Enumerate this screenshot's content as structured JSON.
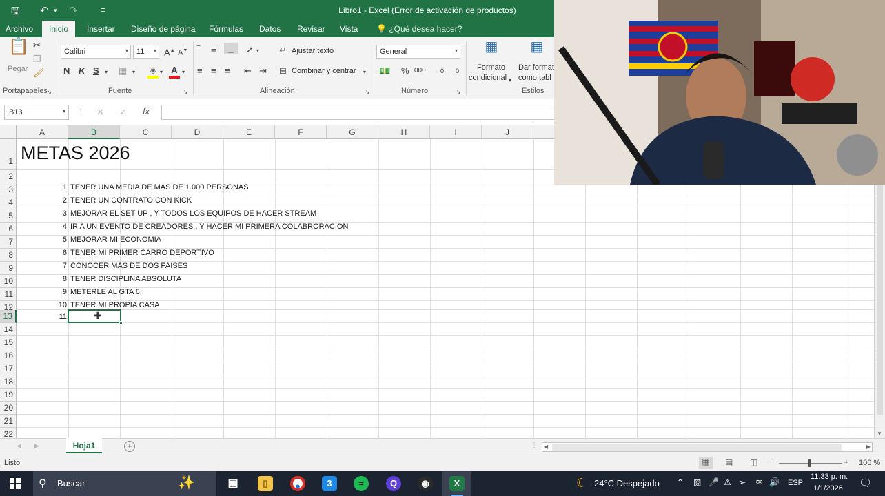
{
  "window": {
    "title": "Libro1 - Excel (Error de activación de productos)"
  },
  "ribbon_tabs": [
    "Archivo",
    "Inicio",
    "Insertar",
    "Diseño de página",
    "Fórmulas",
    "Datos",
    "Revisar",
    "Vista"
  ],
  "tell_me": "¿Qué desea hacer?",
  "ribbon": {
    "paste_label": "Pegar",
    "clipboard_label": "Portapapeles",
    "font_name": "Calibri",
    "font_size": "11",
    "font_label": "Fuente",
    "bold": "N",
    "italic": "K",
    "underline": "S",
    "wrap_text": "Ajustar texto",
    "merge_center": "Combinar y centrar",
    "alignment_label": "Alineación",
    "number_format": "General",
    "number_label": "Número",
    "cond_format_line1": "Formato",
    "cond_format_line2": "condicional",
    "table_format_line1": "Dar format",
    "table_format_line2": "como tabl",
    "styles_label": "Estilos"
  },
  "formula_bar": {
    "name_box": "B13",
    "fx": "fx",
    "formula": ""
  },
  "columns": [
    "A",
    "B",
    "C",
    "D",
    "E",
    "F",
    "G",
    "H",
    "I",
    "J"
  ],
  "rows": [
    "1",
    "2",
    "3",
    "4",
    "5",
    "6",
    "7",
    "8",
    "9",
    "10",
    "11",
    "12",
    "13",
    "14",
    "15",
    "16",
    "17",
    "18",
    "19",
    "20",
    "21",
    "22"
  ],
  "sheet": {
    "title": "METAS 2026",
    "goals": [
      {
        "num": "1",
        "text": "TENER UNA MEDIA DE MAS DE 1.000 PERSONAS"
      },
      {
        "num": "2",
        "text": "TENER UN CONTRATO CON KICK"
      },
      {
        "num": "3",
        "text": "MEJORAR EL SET UP , Y TODOS LOS EQUIPOS DE HACER STREAM"
      },
      {
        "num": "4",
        "text": "IR A UN EVENTO DE CREADORES , Y HACER MI PRIMERA COLABRORACION"
      },
      {
        "num": "5",
        "text": "MEJORAR MI ECONOMIA"
      },
      {
        "num": "6",
        "text": "TENER MI PRIMER CARRO DEPORTIVO"
      },
      {
        "num": "7",
        "text": "CONOCER MAS DE DOS PAISES"
      },
      {
        "num": "8",
        "text": "TENER DISCIPLINA ABSOLUTA"
      },
      {
        "num": "9",
        "text": "METERLE AL GTA 6"
      },
      {
        "num": "10",
        "text": "TENER MI PROPIA CASA"
      }
    ],
    "next_num": "11"
  },
  "sheet_tab": "Hoja1",
  "status": {
    "mode": "Listo",
    "zoom": "100 %"
  },
  "taskbar": {
    "search": "Buscar",
    "weather": "24°C  Despejado",
    "lang": "ESP",
    "time": "11:33 p. m.",
    "date": "1/1/2026"
  },
  "colors": {
    "excel_green": "#217346",
    "taskbar": "#1c2331"
  }
}
